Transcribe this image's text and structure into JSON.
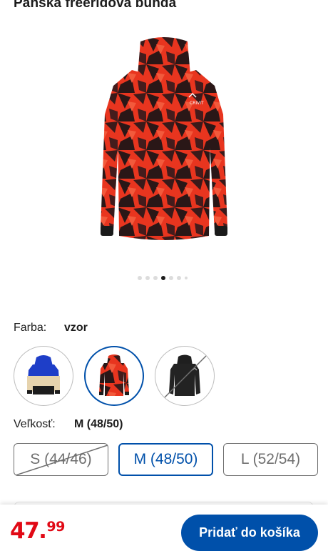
{
  "product": {
    "title": "Pánska freeridová bunda",
    "brand_logo": "CRIVIT"
  },
  "gallery": {
    "image_count": 7,
    "active_index": 3
  },
  "color": {
    "label": "Farba:",
    "selected": "vzor",
    "options": [
      {
        "name": "blue-beige-black",
        "available": true,
        "selected": false
      },
      {
        "name": "red-pattern",
        "available": true,
        "selected": true
      },
      {
        "name": "black",
        "available": false,
        "selected": false
      }
    ]
  },
  "size": {
    "label": "Veľkosť:",
    "selected": "M (48/50)",
    "options": [
      {
        "label": "S (44/46)",
        "available": false,
        "selected": false
      },
      {
        "label": "M (48/50)",
        "available": true,
        "selected": true
      },
      {
        "label": "L (52/54)",
        "available": true,
        "selected": false
      }
    ]
  },
  "price": {
    "integer": "47.",
    "decimal": "99",
    "color": "#e10915"
  },
  "cart": {
    "button_label": "Pridať do košíka",
    "color": "#0050aa"
  }
}
